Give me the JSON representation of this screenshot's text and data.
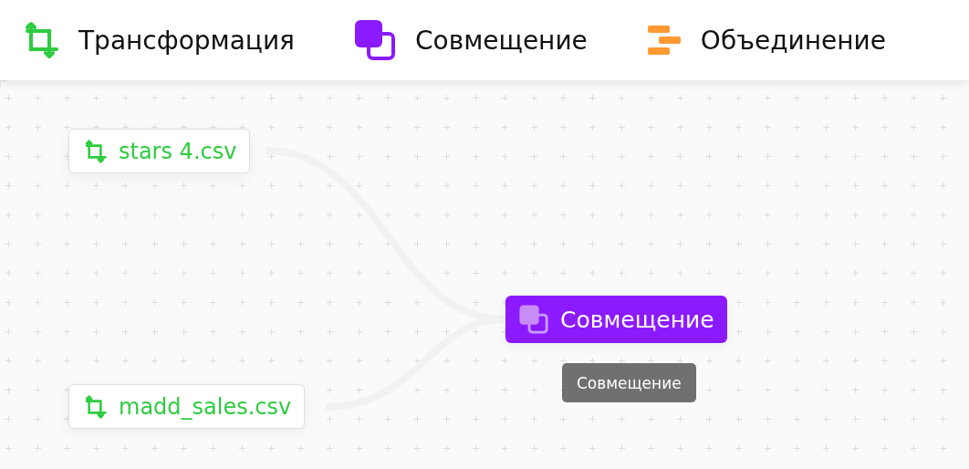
{
  "toolbar": {
    "tools": [
      {
        "kind": "transform",
        "label": "Трансформация"
      },
      {
        "kind": "merge",
        "label": "Совмещение"
      },
      {
        "kind": "join",
        "label": "Объединение"
      }
    ]
  },
  "canvas": {
    "nodes": [
      {
        "kind": "transform",
        "label": "stars 4.csv"
      },
      {
        "kind": "transform",
        "label": "madd_sales.csv"
      },
      {
        "kind": "merge",
        "label": "Совмещение",
        "tooltip": "Совмещение"
      }
    ]
  }
}
